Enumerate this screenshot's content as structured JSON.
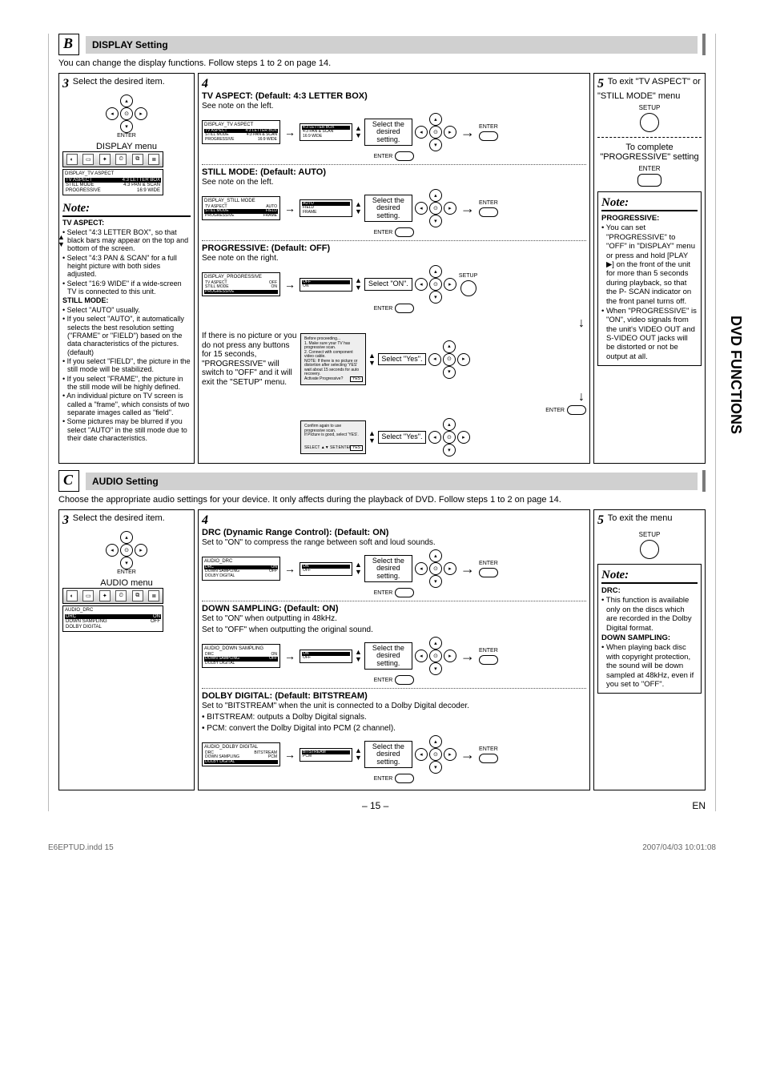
{
  "sectionB": {
    "letter": "B",
    "title": "DISPLAY Setting",
    "intro": "You can change the display functions. Follow steps 1 to 2 on page 14.",
    "step3": {
      "num": "3",
      "text": "Select the desired item.",
      "enter_label": "ENTER",
      "menu_label": "DISPLAY menu",
      "strip_icons": [
        "⚙",
        "▭",
        "🔆",
        "🕑",
        "⧉",
        "≣"
      ],
      "menu": {
        "title": "DISPLAY_TV ASPECT",
        "rows": [
          {
            "k": "TV ASPECT",
            "v": "4:3 LETTER BOX",
            "sel": true
          },
          {
            "k": "STILL MODE",
            "v": "4:3 PAN & SCAN"
          },
          {
            "k": "PROGRESSIVE",
            "v": "16:9 WIDE"
          }
        ]
      }
    },
    "note3": {
      "title": "Note:",
      "tvAspectHead": "TV ASPECT:",
      "tvAspect": [
        "Select \"4:3 LETTER BOX\", so that black bars may appear on the top and bottom of the screen.",
        "Select \"4:3 PAN & SCAN\" for a full height picture with both sides adjusted.",
        "Select \"16:9 WIDE\" if a wide-screen TV is connected to this unit."
      ],
      "stillHead": "STILL MODE:",
      "still": [
        "Select \"AUTO\" usually.",
        "If you select \"AUTO\", it automatically selects the best resolution setting (\"FRAME\" or \"FIELD\") based on the data characteristics of the pictures. (default)",
        "If you select \"FIELD\", the picture in the still mode will be stabilized.",
        "If you select \"FRAME\", the picture in the still mode will be highly defined.",
        "An individual picture on TV screen is called a \"frame\", which consists of two separate images called as \"field\".",
        "Some pictures may be blurred if you select \"AUTO\" in the still mode due to their date characteristics."
      ]
    },
    "step4": {
      "num": "4",
      "tv": {
        "head": "TV ASPECT: (Default: 4:3 LETTER BOX)",
        "sub": "See note on the left.",
        "menuTitle": "DISPLAY_TV ASPECT",
        "left": [
          {
            "k": "TV ASPECT",
            "v": "4:3 LETTER BOX",
            "sel": true
          },
          {
            "k": "STILL MODE",
            "v": "4:3 PAN & SCAN"
          },
          {
            "k": "PROGRESSIVE",
            "v": "16:9 WIDE"
          }
        ],
        "right": [
          {
            "k": "4:3 LETTER BOX",
            "sel": true
          },
          {
            "k": "4:3 PAN & SCAN"
          },
          {
            "k": "16:9 WIDE"
          }
        ],
        "selLabel": "Select the desired setting.",
        "enter": "ENTER"
      },
      "still": {
        "head": "STILL MODE: (Default: AUTO)",
        "sub": "See note on the left.",
        "menuTitle": "DISPLAY_STILL MODE",
        "left": [
          {
            "k": "TV ASPECT",
            "v": "AUTO"
          },
          {
            "k": "STILL MODE",
            "v": "FIELD",
            "sel": true
          },
          {
            "k": "PROGRESSIVE",
            "v": "FRAME"
          }
        ],
        "right": [
          {
            "k": "AUTO",
            "sel": true
          },
          {
            "k": "FIELD"
          },
          {
            "k": "FRAME"
          }
        ],
        "selLabel": "Select the desired setting.",
        "enter": "ENTER"
      },
      "prog": {
        "head": "PROGRESSIVE: (Default: OFF)",
        "sub": "See note on the right.",
        "menuTitle": "DISPLAY_PROGRESSIVE",
        "left": [
          {
            "k": "TV ASPECT",
            "v": "OFF"
          },
          {
            "k": "STILL MODE",
            "v": "ON"
          },
          {
            "k": "PROGRESSIVE",
            "v": "",
            "sel": true
          }
        ],
        "right": [
          {
            "k": "OFF",
            "sel": true
          },
          {
            "k": "ON"
          }
        ],
        "sel1": "Select \"ON\".",
        "setup": "SETUP",
        "osd1": {
          "l1": "Before proceeding...",
          "l2": "1. Make sure your TV has progressive scan.",
          "l3": "2. Connect with component video cable.",
          "l4": "NOTE: If there is no picture or distortion after selecting 'YES' wait about 15 seconds for auto recovery.",
          "l5": "Activate Progressive?",
          "ok": "YES"
        },
        "sel2": "Select \"Yes\".",
        "enter": "ENTER",
        "osd2": {
          "l1": "Confirm again to use progressive scan.",
          "l2": "If Picture is good, select 'YES'.",
          "ok": "YES",
          "foot": "SELECT ▲▼    SET:ENTER"
        },
        "sel3": "Select \"Yes\".",
        "noPic": "If there is no picture or you do not press any buttons for 15 seconds, \"PROGRESSIVE\" will switch to \"OFF\" and it will exit the \"SETUP\" menu."
      }
    },
    "step5": {
      "num": "5",
      "exit": "To exit \"TV ASPECT\" or \"STILL MODE\" menu",
      "setup": "SETUP",
      "complete": "To complete \"PROGRESSIVE\" setting",
      "enter": "ENTER"
    },
    "note5": {
      "title": "Note:",
      "head": "PROGRESSIVE:",
      "body": [
        "You can set \"PROGRESSIVE\" to \"OFF\" in \"DISPLAY\" menu or press and hold [PLAY ▶] on the front of the unit for more than 5 seconds during playback, so that the P- SCAN indicator on the front panel turns off.",
        "When \"PROGRESSIVE\" is \"ON\", video signals from the unit's VIDEO OUT and S-VIDEO OUT jacks will be distorted or not be output at all."
      ]
    }
  },
  "sectionC": {
    "letter": "C",
    "title": "AUDIO Setting",
    "intro": "Choose the appropriate audio settings for your device. It only affects during the playback of DVD. Follow steps 1 to 2 on page 14.",
    "step3": {
      "num": "3",
      "text": "Select the desired item.",
      "enter_label": "ENTER",
      "menu_label": "AUDIO menu",
      "menu": {
        "title": "AUDIO_DRC",
        "rows": [
          {
            "k": "DRC",
            "v": "ON",
            "sel": true
          },
          {
            "k": "DOWN SAMPLING",
            "v": "OFF"
          },
          {
            "k": "DOLBY DIGITAL",
            "v": ""
          }
        ]
      }
    },
    "step4": {
      "num": "4",
      "drc": {
        "head": "DRC (Dynamic Range Control): (Default: ON)",
        "sub": "Set to \"ON\" to compress the range between soft and loud sounds.",
        "menuTitle": "AUDIO_DRC",
        "left": [
          {
            "k": "DRC",
            "v": "ON",
            "sel": true
          },
          {
            "k": "DOWN SAMPLING",
            "v": "OFF"
          },
          {
            "k": "DOLBY DIGITAL",
            "v": ""
          }
        ],
        "right": [
          {
            "k": "ON",
            "sel": true
          },
          {
            "k": "OFF"
          }
        ],
        "selLabel": "Select the desired setting.",
        "enter": "ENTER"
      },
      "down": {
        "head": "DOWN SAMPLING: (Default: ON)",
        "sub": "Set to \"ON\" when outputting in 48kHz.",
        "sub2": "Set to \"OFF\" when outputting the original sound.",
        "menuTitle": "AUDIO_DOWN SAMPLING",
        "left": [
          {
            "k": "DRC",
            "v": "ON"
          },
          {
            "k": "DOWN SAMPLING",
            "v": "OFF",
            "sel": true
          },
          {
            "k": "DOLBY DIGITAL",
            "v": ""
          }
        ],
        "right": [
          {
            "k": "ON",
            "sel": true
          },
          {
            "k": "OFF"
          }
        ],
        "selLabel": "Select the desired setting.",
        "enter": "ENTER"
      },
      "dolby": {
        "head": "DOLBY DIGITAL: (Default: BITSTREAM)",
        "sub": "Set to \"BITSTREAM\" when the unit is connected to a Dolby Digital decoder.",
        "b1": "• BITSTREAM: outputs a Dolby Digital signals.",
        "b2": "• PCM: convert the Dolby Digital into PCM (2 channel).",
        "menuTitle": "AUDIO_DOLBY DIGITAL",
        "left": [
          {
            "k": "DRC",
            "v": "BITSTREAM"
          },
          {
            "k": "DOWN SAMPLING",
            "v": "PCM"
          },
          {
            "k": "DOLBY DIGITAL",
            "v": "",
            "sel": true
          }
        ],
        "right": [
          {
            "k": "BITSTREAM",
            "sel": true
          },
          {
            "k": "PCM"
          }
        ],
        "selLabel": "Select the desired setting.",
        "enter": "ENTER"
      }
    },
    "step5": {
      "num": "5",
      "text": "To exit the menu",
      "setup": "SETUP"
    },
    "note5": {
      "title": "Note:",
      "drcHead": "DRC:",
      "drc": "This function is available only on the discs which are recorded in the Dolby Digital format.",
      "downHead": "DOWN SAMPLING:",
      "down": "When playing back disc with copyright protection, the sound will be down sampled at 48kHz, even if you set to \"OFF\"."
    }
  },
  "sideTab": "DVD FUNCTIONS",
  "footer": {
    "page": "– 15 –",
    "lang": "EN"
  },
  "print": {
    "file": "E6EPTUD.indd   15",
    "stamp": "2007/04/03   10:01:08"
  }
}
